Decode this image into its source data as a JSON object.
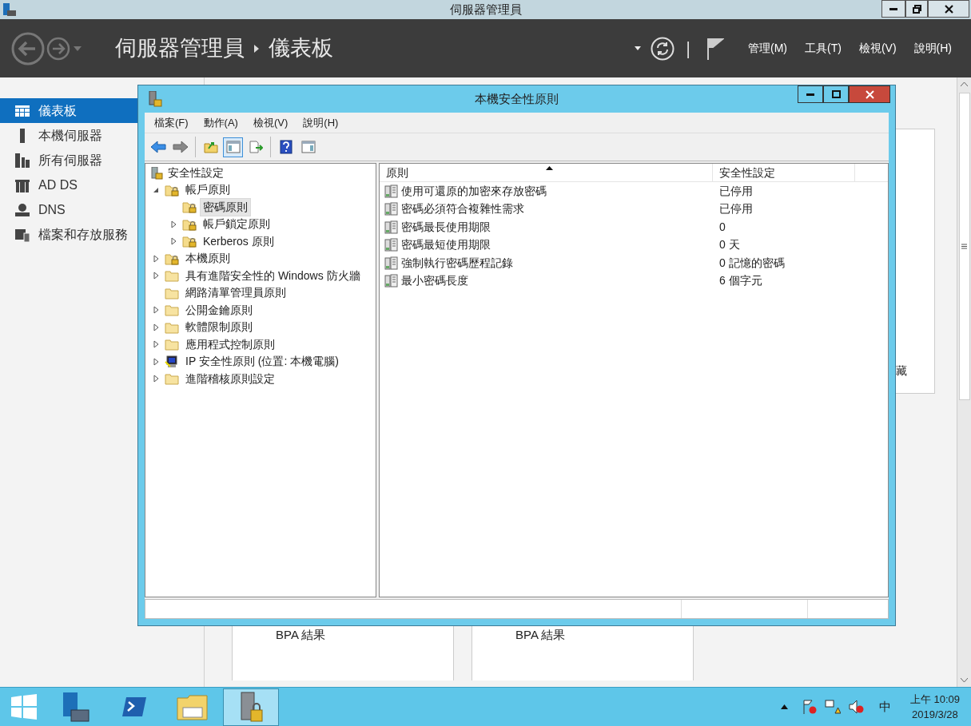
{
  "window": {
    "title": "伺服器管理員"
  },
  "header": {
    "breadcrumb": [
      "伺服器管理員",
      "儀表板"
    ],
    "separator": "|",
    "menus": [
      "管理(M)",
      "工具(T)",
      "檢視(V)",
      "說明(H)"
    ]
  },
  "sidebar": {
    "items": [
      {
        "label": "儀表板",
        "selected": true,
        "kind": "dashboard"
      },
      {
        "label": "本機伺服器",
        "selected": false,
        "kind": "server"
      },
      {
        "label": "所有伺服器",
        "selected": false,
        "kind": "servers"
      },
      {
        "label": "AD DS",
        "selected": false,
        "kind": "adds"
      },
      {
        "label": "DNS",
        "selected": false,
        "kind": "dns"
      },
      {
        "label": "檔案和存放服務",
        "selected": false,
        "kind": "files"
      }
    ]
  },
  "background": {
    "partial_text": "藏",
    "tiles": [
      "BPA 結果",
      "BPA 結果"
    ]
  },
  "dialog": {
    "title": "本機安全性原則",
    "menu": [
      "檔案(F)",
      "動作(A)",
      "檢視(V)",
      "說明(H)"
    ],
    "toolbar": [
      {
        "kind": "back",
        "pressed": false
      },
      {
        "kind": "forward",
        "pressed": false
      },
      {
        "kind": "up",
        "pressed": false
      },
      {
        "kind": "tree",
        "pressed": true
      },
      {
        "kind": "export",
        "pressed": false
      },
      {
        "kind": "help",
        "pressed": false
      },
      {
        "kind": "pane",
        "pressed": false
      }
    ],
    "tree": {
      "label": "安全性設定",
      "kind": "root",
      "children": [
        {
          "label": "帳戶原則",
          "kind": "locked",
          "expanded": true,
          "selected": false,
          "children": [
            {
              "label": "密碼原則",
              "kind": "locked",
              "selected": true
            },
            {
              "label": "帳戶鎖定原則",
              "kind": "locked",
              "expanded": false,
              "selected": false
            },
            {
              "label": "Kerberos 原則",
              "kind": "locked",
              "expanded": false,
              "selected": false
            }
          ]
        },
        {
          "label": "本機原則",
          "kind": "locked",
          "expanded": false,
          "selected": false
        },
        {
          "label": "具有進階安全性的 Windows 防火牆",
          "kind": "folder",
          "expanded": false,
          "selected": false
        },
        {
          "label": "網路清單管理員原則",
          "kind": "folder",
          "selected": false
        },
        {
          "label": "公開金鑰原則",
          "kind": "folder",
          "expanded": false,
          "selected": false
        },
        {
          "label": "軟體限制原則",
          "kind": "folder",
          "expanded": false,
          "selected": false
        },
        {
          "label": "應用程式控制原則",
          "kind": "folder",
          "expanded": false,
          "selected": false
        },
        {
          "label": "IP 安全性原則 (位置: 本機電腦)",
          "kind": "ipsec",
          "expanded": false,
          "selected": false
        },
        {
          "label": "進階稽核原則設定",
          "kind": "folder",
          "expanded": false,
          "selected": false
        }
      ]
    },
    "table": {
      "columns": [
        {
          "label": "原則",
          "sorted": true
        },
        {
          "label": "安全性設定",
          "sorted": false
        }
      ],
      "rows": [
        {
          "policy": "使用可還原的加密來存放密碼",
          "setting": "已停用"
        },
        {
          "policy": "密碼必須符合複雜性需求",
          "setting": "已停用"
        },
        {
          "policy": "密碼最長使用期限",
          "setting": "0"
        },
        {
          "policy": "密碼最短使用期限",
          "setting": "0 天"
        },
        {
          "policy": "強制執行密碼歷程記錄",
          "setting": "0 記憶的密碼"
        },
        {
          "policy": "最小密碼長度",
          "setting": "6 個字元"
        }
      ]
    }
  },
  "taskbar": {
    "apps": [
      {
        "kind": "servermanager",
        "active": false
      },
      {
        "kind": "powershell",
        "active": false
      },
      {
        "kind": "explorer",
        "active": false
      },
      {
        "kind": "secpol",
        "active": true
      }
    ],
    "ime": "中",
    "time": "上午 10:09",
    "date": "2019/3/28"
  }
}
